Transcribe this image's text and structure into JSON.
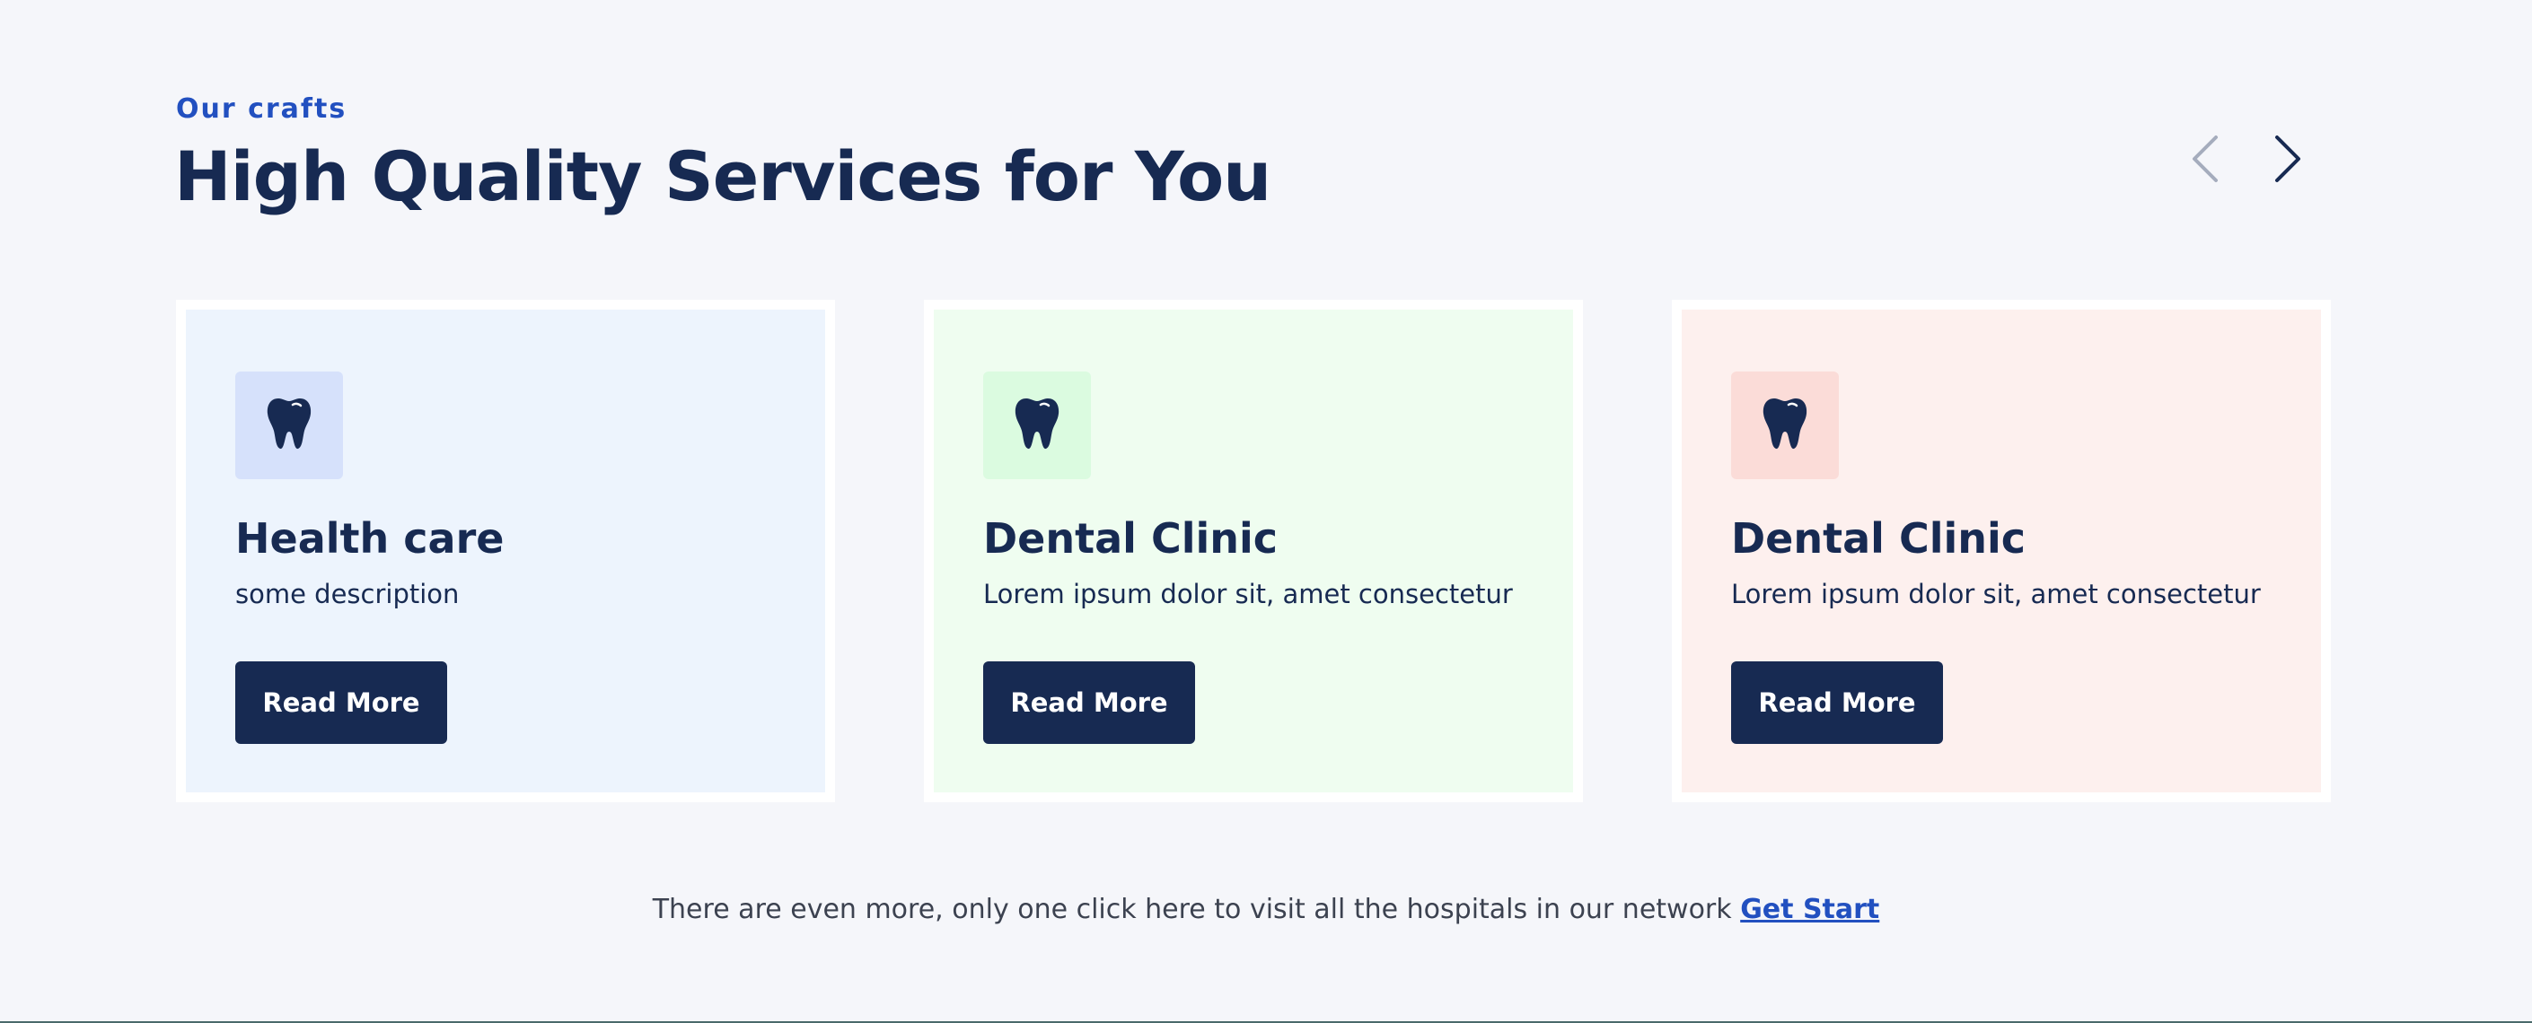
{
  "section": {
    "eyebrow": "Our crafts",
    "title": "High Quality Services for You"
  },
  "carousel": {
    "prev_icon": "chevron-left-icon",
    "next_icon": "chevron-right-icon"
  },
  "cards": [
    {
      "title": "Health care",
      "description": "some description",
      "button_label": "Read More",
      "icon": "tooth-icon",
      "background": "#edf4fd",
      "icon_background": "#d6e1fb"
    },
    {
      "title": "Dental Clinic",
      "description": "Lorem ipsum dolor sit, amet consectetur",
      "button_label": "Read More",
      "icon": "tooth-icon",
      "background": "#effdf0",
      "icon_background": "#dbfbe0"
    },
    {
      "title": "Dental Clinic",
      "description": "Lorem ipsum dolor sit, amet consectetur",
      "button_label": "Read More",
      "icon": "tooth-icon",
      "background": "#fdf0ee",
      "icon_background": "#fbdcd8"
    }
  ],
  "footer": {
    "text": "There are even more, only one click here to visit all the hospitals in our network",
    "link_label": "Get Start"
  },
  "colors": {
    "accent": "#2250c0",
    "navy": "#172a52",
    "page_background": "#f5f6fa"
  }
}
